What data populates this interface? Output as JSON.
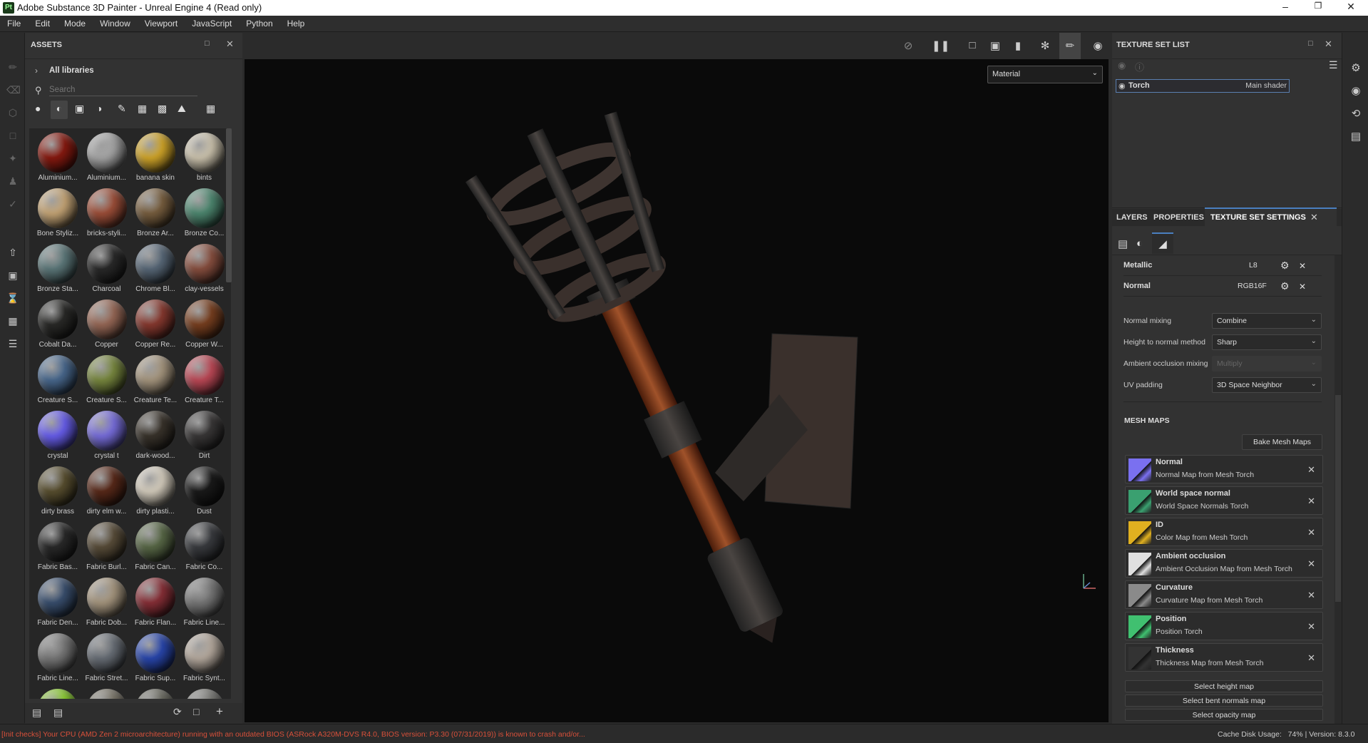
{
  "window": {
    "title": "Adobe Substance 3D Painter - Unreal Engine 4 (Read only)",
    "logo": "Pt"
  },
  "menu": [
    "File",
    "Edit",
    "Mode",
    "Window",
    "Viewport",
    "JavaScript",
    "Python",
    "Help"
  ],
  "assets": {
    "title": "ASSETS",
    "library": "All libraries",
    "search_placeholder": "Search",
    "materials": [
      {
        "name": "Aluminium...",
        "color": "#8a1a10"
      },
      {
        "name": "Aluminium...",
        "color": "#a8a8a8"
      },
      {
        "name": "banana skin",
        "color": "#d4a82a"
      },
      {
        "name": "bints",
        "color": "#cfc6b0"
      },
      {
        "name": "Bone Styliz...",
        "color": "#c9a878"
      },
      {
        "name": "bricks-styli...",
        "color": "#a0503a"
      },
      {
        "name": "Bronze Ar...",
        "color": "#7a6040"
      },
      {
        "name": "Bronze Co...",
        "color": "#4f8a72"
      },
      {
        "name": "Bronze Sta...",
        "color": "#5e7a7c"
      },
      {
        "name": "Charcoal",
        "color": "#2a2a2a"
      },
      {
        "name": "Chrome Bl...",
        "color": "#5a6a7a"
      },
      {
        "name": "clay-vessels",
        "color": "#8a5040"
      },
      {
        "name": "Cobalt Da...",
        "color": "#2a2a28"
      },
      {
        "name": "Copper",
        "color": "#9a6a58"
      },
      {
        "name": "Copper Re...",
        "color": "#8a3a30"
      },
      {
        "name": "Copper W...",
        "color": "#7a4020"
      },
      {
        "name": "Creature S...",
        "color": "#4a6a90"
      },
      {
        "name": "Creature S...",
        "color": "#7a8a40"
      },
      {
        "name": "Creature Te...",
        "color": "#a89880"
      },
      {
        "name": "Creature T...",
        "color": "#c04a58"
      },
      {
        "name": "crystal",
        "color": "#6a60f0"
      },
      {
        "name": "crystal t",
        "color": "#7a70e0"
      },
      {
        "name": "dark-wood...",
        "color": "#3a342c"
      },
      {
        "name": "Dirt",
        "color": "#3a3838"
      },
      {
        "name": "dirty brass",
        "color": "#5a5030"
      },
      {
        "name": "dirty elm w...",
        "color": "#5a2a1a"
      },
      {
        "name": "dirty plasti...",
        "color": "#d8d0c0"
      },
      {
        "name": "Dust",
        "color": "#1a1a1a"
      },
      {
        "name": "Fabric Bas...",
        "color": "#2a2a2a"
      },
      {
        "name": "Fabric Burl...",
        "color": "#5a4e3a"
      },
      {
        "name": "Fabric Can...",
        "color": "#5a6a48"
      },
      {
        "name": "Fabric Co...",
        "color": "#3a3c40"
      },
      {
        "name": "Fabric Den...",
        "color": "#3a5070"
      },
      {
        "name": "Fabric Dob...",
        "color": "#a89880"
      },
      {
        "name": "Fabric Flan...",
        "color": "#8a3038"
      },
      {
        "name": "Fabric Line...",
        "color": "#7a7a7a"
      },
      {
        "name": "Fabric Line...",
        "color": "#7a7a7a"
      },
      {
        "name": "Fabric Stret...",
        "color": "#6a7078"
      },
      {
        "name": "Fabric Sup...",
        "color": "#2a48b0"
      },
      {
        "name": "Fabric Synt...",
        "color": "#b8aca0"
      },
      {
        "name": "",
        "color": "#8ad02a"
      },
      {
        "name": "",
        "color": "#7a7568"
      },
      {
        "name": "",
        "color": "#6a6a60"
      },
      {
        "name": "",
        "color": "#7a7a76"
      }
    ]
  },
  "viewport": {
    "channel": "Material"
  },
  "texture_set_list": {
    "title": "TEXTURE SET LIST",
    "item": {
      "name": "Torch",
      "shader": "Main shader"
    }
  },
  "tabs": [
    {
      "label": "LAYERS"
    },
    {
      "label": "PROPERTIES"
    },
    {
      "label": "TEXTURE SET SETTINGS"
    }
  ],
  "channels": [
    {
      "name": "Metallic",
      "format": "L8"
    },
    {
      "name": "Normal",
      "format": "RGB16F"
    }
  ],
  "settings": [
    {
      "label": "Normal mixing",
      "value": "Combine"
    },
    {
      "label": "Height to normal method",
      "value": "Sharp"
    },
    {
      "label": "Ambient occlusion mixing",
      "value": "Multiply"
    },
    {
      "label": "UV padding",
      "value": "3D Space Neighbor"
    }
  ],
  "mesh_maps": {
    "title": "MESH MAPS",
    "bake_label": "Bake Mesh Maps",
    "items": [
      {
        "name": "Normal",
        "source": "Normal Map from Mesh Torch",
        "color": "#7a70f0"
      },
      {
        "name": "World space normal",
        "source": "World Space Normals Torch",
        "color": "#3aa070"
      },
      {
        "name": "ID",
        "source": "Color Map from Mesh Torch",
        "color": "#e0b020"
      },
      {
        "name": "Ambient occlusion",
        "source": "Ambient Occlusion Map from Mesh Torch",
        "color": "#e0e0e0"
      },
      {
        "name": "Curvature",
        "source": "Curvature Map from Mesh Torch",
        "color": "#8a8a8a"
      },
      {
        "name": "Position",
        "source": "Position Torch",
        "color": "#40c070"
      },
      {
        "name": "Thickness",
        "source": "Thickness Map from Mesh Torch",
        "color": "#333333"
      }
    ],
    "select_buttons": [
      "Select height map",
      "Select bent normals map",
      "Select opacity map"
    ]
  },
  "status": {
    "message": "[Init checks] Your CPU (AMD Zen 2 microarchitecture) running with an outdated BIOS (ASRock A320M-DVS R4.0, BIOS version: P3.30 (07/31/2019)) is known to crash and/or...",
    "cache_label": "Cache Disk Usage:",
    "cache_value": "74%",
    "version": "| Version: 8.3.0"
  }
}
